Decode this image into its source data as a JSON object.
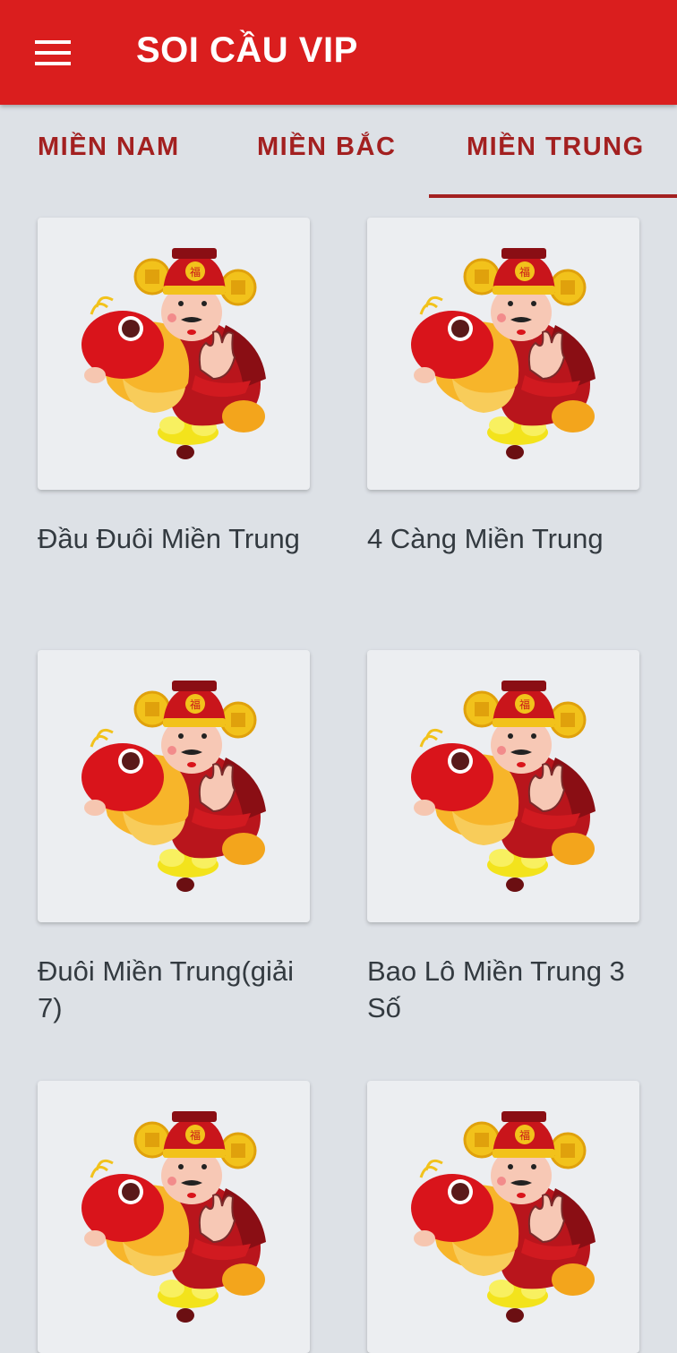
{
  "app_bar": {
    "title": "SOI CẦU VIP",
    "menu_icon": "hamburger-menu-icon",
    "background": "#da1e1e"
  },
  "tabs": [
    {
      "label": "MIỀN NAM",
      "selected": false
    },
    {
      "label": "MIỀN BẮC",
      "selected": false
    },
    {
      "label": "MIỀN TRUNG",
      "selected": true
    }
  ],
  "accent_color": "#a32020",
  "items": [
    {
      "title": "Đầu Đuôi Miền Trung",
      "image": "than-tai-icon"
    },
    {
      "title": "4 Càng Miền Trung",
      "image": "than-tai-icon"
    },
    {
      "title": "Đuôi Miền Trung(giải 7)",
      "image": "than-tai-icon"
    },
    {
      "title": "Bao Lô Miền Trung 3 Số",
      "image": "than-tai-icon"
    },
    {
      "title": "",
      "image": "than-tai-icon"
    },
    {
      "title": "",
      "image": "than-tai-icon"
    }
  ]
}
